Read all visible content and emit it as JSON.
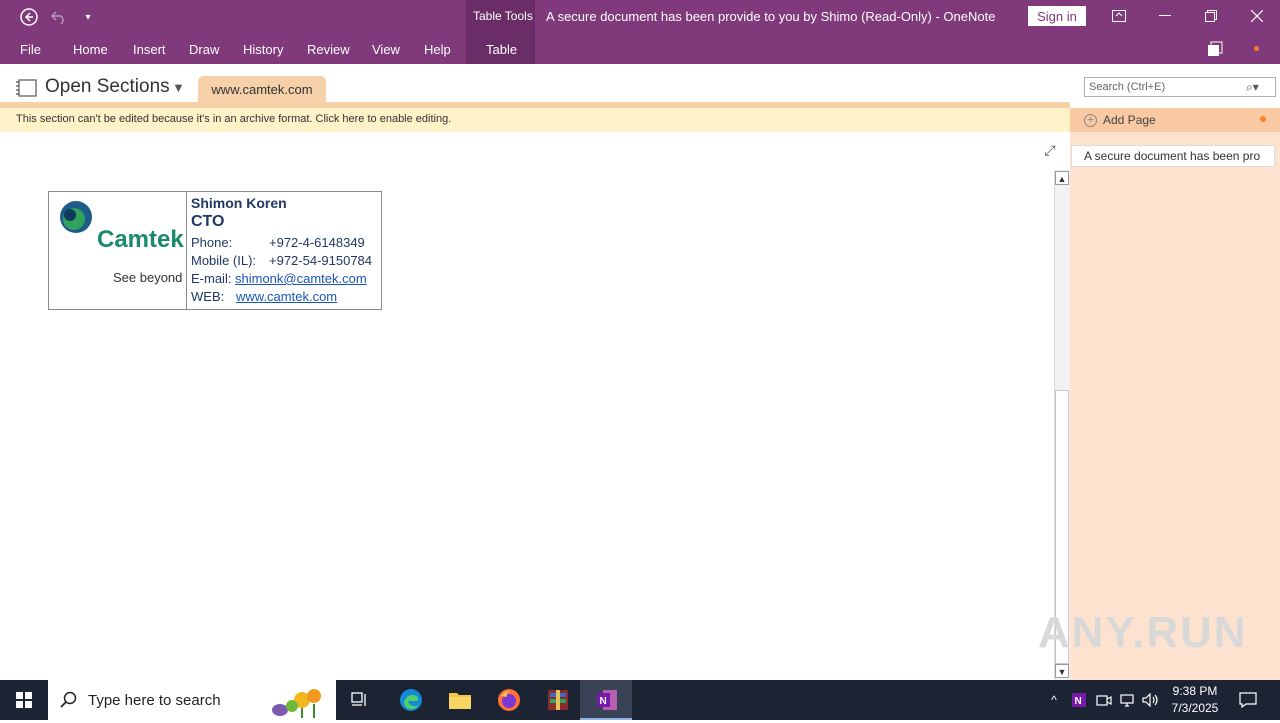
{
  "titlebar": {
    "table_tools": "Table Tools",
    "title": "A secure document has been provide to you by Shimo (Read-Only)  -  OneNote",
    "sign_in": "Sign in"
  },
  "ribbon": {
    "tabs": [
      "File",
      "Home",
      "Insert",
      "Draw",
      "History",
      "Review",
      "View",
      "Help",
      "Table"
    ]
  },
  "nav": {
    "open_sections": "Open Sections",
    "section_tab": "www.camtek.com",
    "search_placeholder": "Search (Ctrl+E)"
  },
  "info_bar": "This section can't be edited because it's in an archive format. Click here to enable editing.",
  "pages": {
    "add_page": "Add Page",
    "items": [
      "A secure document has been pro"
    ]
  },
  "card": {
    "logo_text": "Camtek",
    "tagline": "See beyond",
    "name": "Shimon Koren",
    "title": "CTO",
    "phone_label": "Phone:",
    "phone": "+972-4-6148349",
    "mobile_label": "Mobile (IL):",
    "mobile": "+972-54-9150784",
    "email_label": "E-mail:",
    "email": "shimonk@camtek.com",
    "web_label": "WEB:",
    "web": "www.camtek.com"
  },
  "taskbar": {
    "search_placeholder": "Type here to search",
    "time": "9:38 PM",
    "date": "7/3/2025"
  },
  "watermark": "ANY.RUN",
  "colors": {
    "accent": "#80397b",
    "section_tab": "#f5d0a9",
    "info_bar": "#fdf2c8",
    "pages_pane": "#fde3cf"
  }
}
